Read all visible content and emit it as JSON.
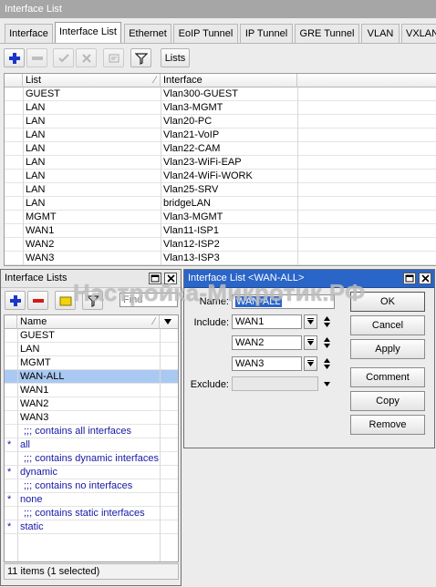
{
  "main_window": {
    "title": "Interface List",
    "tabs": [
      "Interface",
      "Interface List",
      "Ethernet",
      "EoIP Tunnel",
      "IP Tunnel",
      "GRE Tunnel",
      "VLAN",
      "VXLAN"
    ],
    "active_tab": "Interface List",
    "toolbar": {
      "lists_button": "Lists"
    },
    "table": {
      "columns": [
        "List",
        "Interface"
      ],
      "rows": [
        [
          "GUEST",
          "Vlan300-GUEST"
        ],
        [
          "LAN",
          "Vlan3-MGMT"
        ],
        [
          "LAN",
          "Vlan20-PC"
        ],
        [
          "LAN",
          "Vlan21-VoIP"
        ],
        [
          "LAN",
          "Vlan22-CAM"
        ],
        [
          "LAN",
          "Vlan23-WiFi-EAP"
        ],
        [
          "LAN",
          "Vlan24-WiFi-WORK"
        ],
        [
          "LAN",
          "Vlan25-SRV"
        ],
        [
          "LAN",
          "bridgeLAN"
        ],
        [
          "MGMT",
          "Vlan3-MGMT"
        ],
        [
          "WAN1",
          "Vlan11-ISP1"
        ],
        [
          "WAN2",
          "Vlan12-ISP2"
        ],
        [
          "WAN3",
          "Vlan13-ISP3"
        ]
      ]
    }
  },
  "lists_window": {
    "title": "Interface Lists",
    "search_placeholder": "Find",
    "column": "Name",
    "rows": [
      {
        "flag": "",
        "name": "GUEST",
        "comment": false
      },
      {
        "flag": "",
        "name": "LAN",
        "comment": false
      },
      {
        "flag": "",
        "name": "MGMT",
        "comment": false
      },
      {
        "flag": "",
        "name": "WAN-ALL",
        "comment": false,
        "selected": true
      },
      {
        "flag": "",
        "name": "WAN1",
        "comment": false
      },
      {
        "flag": "",
        "name": "WAN2",
        "comment": false
      },
      {
        "flag": "",
        "name": "WAN3",
        "comment": false
      },
      {
        "flag": "",
        "name": ";;; contains all interfaces",
        "comment": true
      },
      {
        "flag": "*",
        "name": "all",
        "comment": false,
        "builtin": true
      },
      {
        "flag": "",
        "name": ";;; contains dynamic interfaces",
        "comment": true
      },
      {
        "flag": "*",
        "name": "dynamic",
        "comment": false,
        "builtin": true
      },
      {
        "flag": "",
        "name": ";;; contains no interfaces",
        "comment": true
      },
      {
        "flag": "*",
        "name": "none",
        "comment": false,
        "builtin": true
      },
      {
        "flag": "",
        "name": ";;; contains static interfaces",
        "comment": true
      },
      {
        "flag": "*",
        "name": "static",
        "comment": false,
        "builtin": true
      }
    ],
    "status": "11 items (1 selected)"
  },
  "dialog": {
    "title": "Interface List <WAN-ALL>",
    "name_label": "Name:",
    "name_value": "WAN-ALL",
    "include_label": "Include:",
    "include_values": [
      "WAN1",
      "WAN2",
      "WAN3"
    ],
    "exclude_label": "Exclude:",
    "buttons": [
      "OK",
      "Cancel",
      "Apply",
      "Comment",
      "Copy",
      "Remove"
    ]
  },
  "watermark": "Настройка-Микротик.РФ",
  "colors": {
    "selection": "#a9c9f2",
    "comment": "#1717a6",
    "active_title": "#2a65c8",
    "add_icon": "#1b36c9",
    "remove_icon": "#d11b1b"
  }
}
